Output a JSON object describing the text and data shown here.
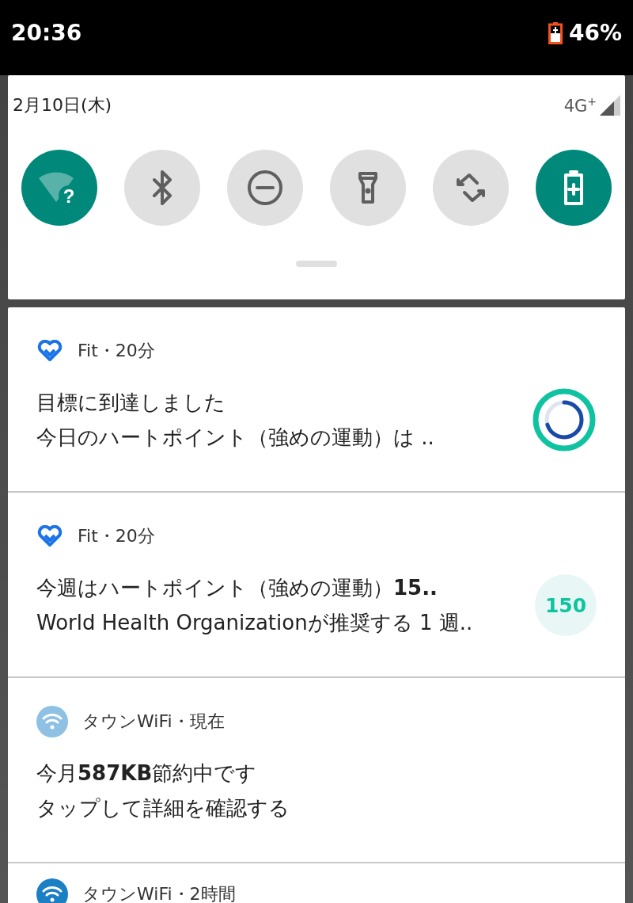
{
  "status_bar": {
    "time": "20:36",
    "battery": "46%"
  },
  "quick_settings": {
    "date": "2月10日(木)",
    "network": "4G",
    "network_suffix": "+",
    "tiles": [
      {
        "kind": "wifi",
        "on": true,
        "glyph": "?"
      },
      {
        "kind": "bluetooth",
        "on": false
      },
      {
        "kind": "dnd",
        "on": false
      },
      {
        "kind": "flashlight",
        "on": false
      },
      {
        "kind": "rotate",
        "on": false
      },
      {
        "kind": "battery_saver",
        "on": true
      }
    ]
  },
  "notifications": [
    {
      "kind": "fit",
      "header": "Fit・20分",
      "lines": [
        "目標に到達しました",
        "今日のハートポイント（強めの運動）は .."
      ],
      "ring": true
    },
    {
      "kind": "fit",
      "header": "Fit・20分",
      "lines": [
        "今週はハートポイント（強めの運動）**15..**",
        "World Health Organizationが推奨する 1 週.."
      ],
      "badge": "150"
    },
    {
      "kind": "wifi_light",
      "header": "タウンWiFi・現在",
      "lines": [
        "今月**587KB**節約中です",
        "タップして詳細を確認する"
      ]
    },
    {
      "kind": "wifi_dark",
      "header": "タウンWiFi・2時間"
    }
  ]
}
